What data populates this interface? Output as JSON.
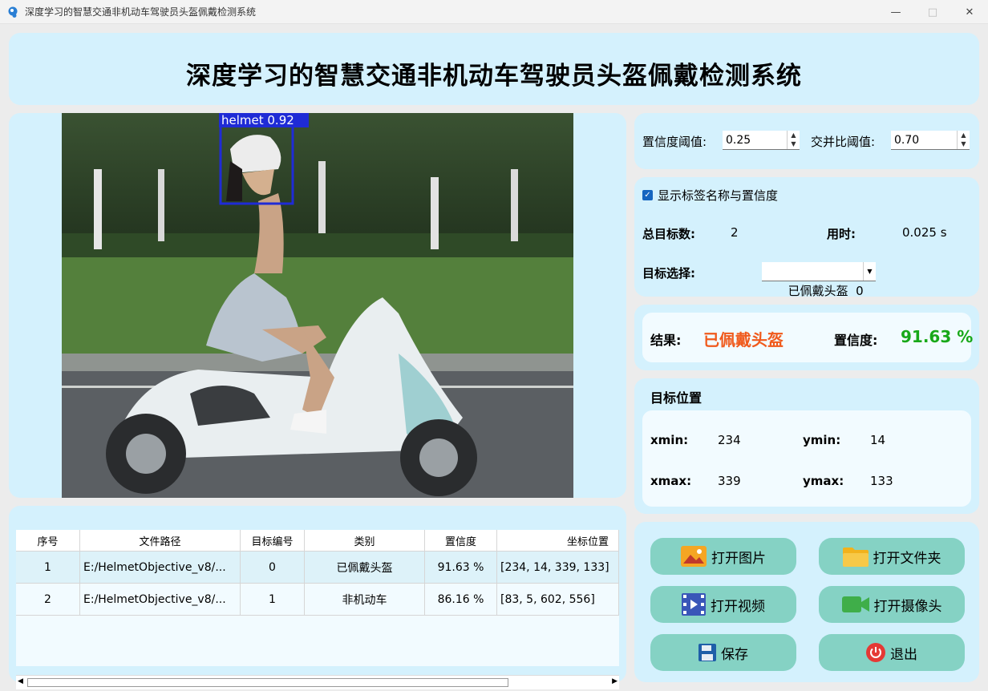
{
  "window": {
    "title": "深度学习的智慧交通非机动车驾驶员头盔佩戴检测系统",
    "minimize": "—",
    "maximize": "□",
    "close": "✕"
  },
  "header": {
    "title": "深度学习的智慧交通非机动车驾驶员头盔佩戴检测系统"
  },
  "image": {
    "detection_label": "helmet 0.92"
  },
  "thresholds": {
    "conf_label": "置信度阈值:",
    "conf_value": "0.25",
    "iou_label": "交并比阈值:",
    "iou_value": "0.70"
  },
  "options": {
    "show_label_checkbox": "显示标签名称与置信度",
    "show_label_checked": true,
    "total_label": "总目标数:",
    "total_value": "2",
    "time_label": "用时:",
    "time_value": "0.025 s",
    "select_label": "目标选择:",
    "select_value": "已佩戴头盔  0"
  },
  "result": {
    "result_label": "结果:",
    "result_value": "已佩戴头盔",
    "conf_label": "置信度:",
    "conf_value": "91.63 %",
    "result_color": "#f05a1c",
    "conf_color": "#18a818"
  },
  "position": {
    "title": "目标位置",
    "xmin_label": "xmin:",
    "xmin": "234",
    "ymin_label": "ymin:",
    "ymin": "14",
    "xmax_label": "xmax:",
    "xmax": "339",
    "ymax_label": "ymax:",
    "ymax": "133"
  },
  "buttons": {
    "open_image": "打开图片",
    "open_folder": "打开文件夹",
    "open_video": "打开视频",
    "open_camera": "打开摄像头",
    "save": "保存",
    "exit": "退出"
  },
  "table": {
    "headers": [
      "序号",
      "文件路径",
      "目标编号",
      "类别",
      "置信度",
      "坐标位置"
    ],
    "rows": [
      [
        "1",
        "E:/HelmetObjective_v8/...",
        "0",
        "已佩戴头盔",
        "91.63 %",
        "[234, 14, 339, 133]"
      ],
      [
        "2",
        "E:/HelmetObjective_v8/...",
        "1",
        "非机动车",
        "86.16 %",
        "[83, 5, 602, 556]"
      ]
    ]
  }
}
